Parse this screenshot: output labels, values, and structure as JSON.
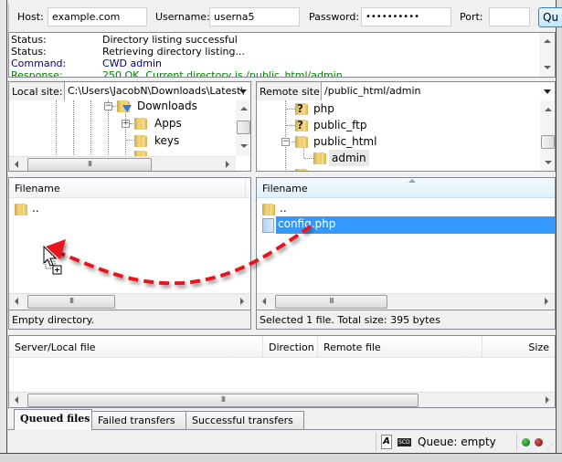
{
  "quickconnect": {
    "host_label": "Host:",
    "host_value": "example.com",
    "username_label": "Username:",
    "username_value": "userna5",
    "password_label": "Password:",
    "password_value": "••••••••••",
    "port_label": "Port:",
    "port_value": "",
    "connect_button_label": "Qu"
  },
  "message_log": [
    {
      "type": "Status:",
      "message": "Directory listing successful",
      "kind": "status"
    },
    {
      "type": "Status:",
      "message": "Retrieving directory listing...",
      "kind": "status"
    },
    {
      "type": "Command:",
      "message": "CWD admin",
      "kind": "command"
    },
    {
      "type": "Response:",
      "message": "250 OK. Current directory is /public_html/admin",
      "kind": "response"
    }
  ],
  "local": {
    "site_label": "Local site:",
    "site_path": "C:\\Users\\JacobN\\Downloads\\Latest\\",
    "tree": [
      {
        "name": "Downloads",
        "icon": "folder-download-icon",
        "expander": "minus"
      },
      {
        "name": "Apps",
        "icon": "folder-icon",
        "expander": "plus"
      },
      {
        "name": "keys",
        "icon": "folder-icon",
        "expander": ""
      }
    ],
    "column_filename": "Filename",
    "files": [
      {
        "name": "..",
        "icon": "folder-icon"
      }
    ],
    "status": "Empty directory."
  },
  "remote": {
    "site_label": "Remote site:",
    "site_path": "/public_html/admin",
    "tree": [
      {
        "name": "php",
        "icon": "folder-unknown-icon"
      },
      {
        "name": "public_ftp",
        "icon": "folder-unknown-icon"
      },
      {
        "name": "public_html",
        "icon": "folder-icon",
        "expander": "minus"
      },
      {
        "name": "admin",
        "icon": "folder-icon",
        "selected": true
      }
    ],
    "column_filename": "Filename",
    "files": [
      {
        "name": "..",
        "icon": "folder-icon"
      },
      {
        "name": "config.php",
        "icon": "file-icon",
        "selected": true
      }
    ],
    "status": "Selected 1 file. Total size: 395 bytes"
  },
  "queue": {
    "columns": [
      "Server/Local file",
      "Direction",
      "Remote file",
      "Size"
    ]
  },
  "tabs": [
    {
      "label": "Queued files",
      "active": true
    },
    {
      "label": "Failed transfers",
      "active": false
    },
    {
      "label": "Successful transfers",
      "active": false
    }
  ],
  "statusbar": {
    "speed_limit_badge": "SCD",
    "queue_text": "Queue: empty"
  },
  "annotation": {
    "description": "drag config.php from remote file list to local file list",
    "arrow_color": "#e8191c"
  }
}
